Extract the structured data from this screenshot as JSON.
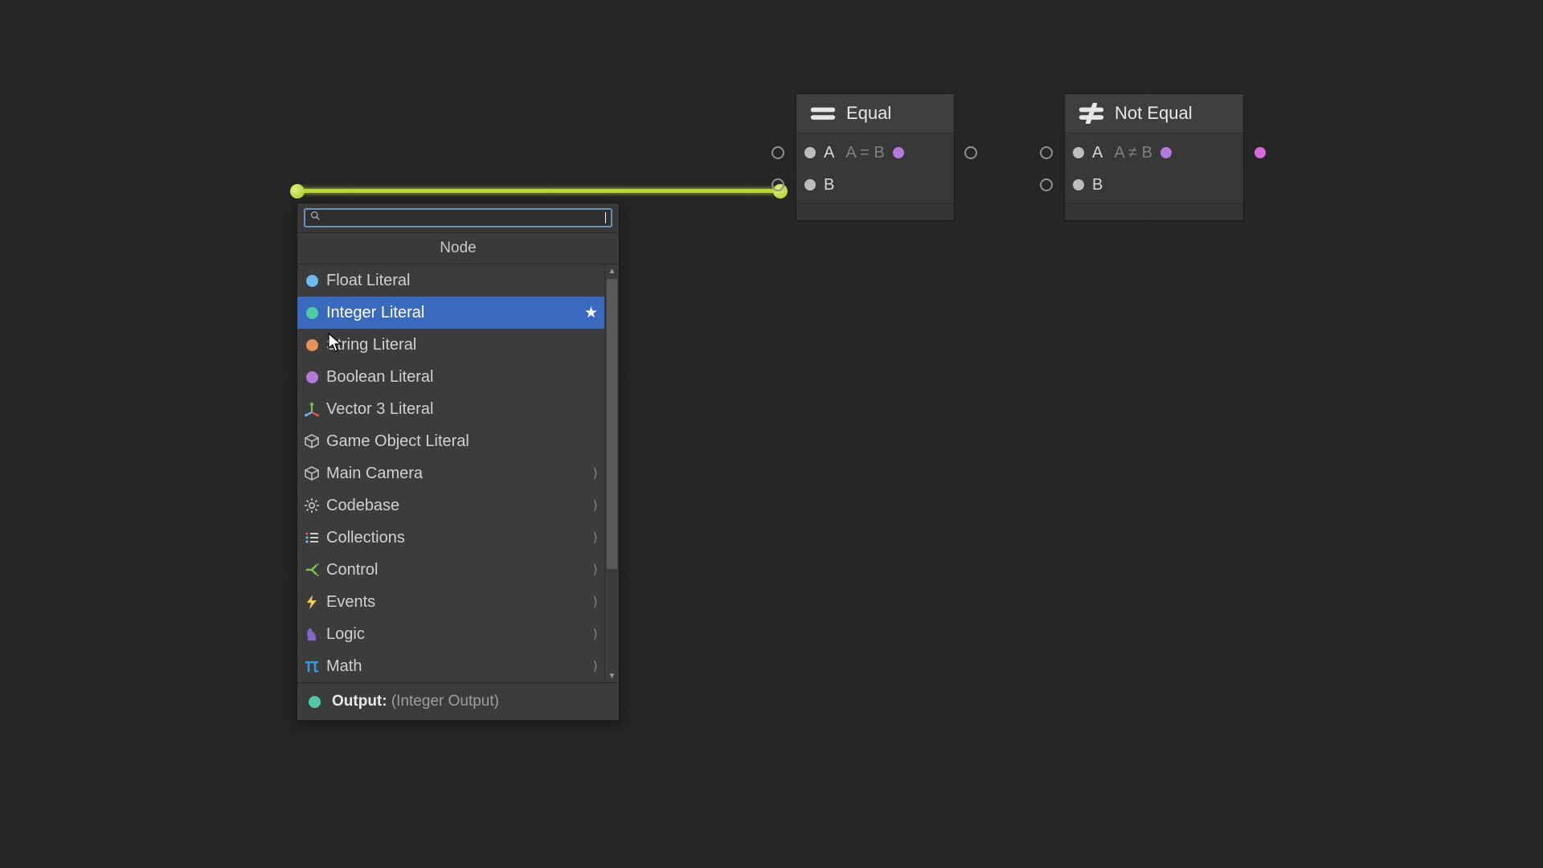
{
  "popup": {
    "header": "Node",
    "search_value": "",
    "items": [
      {
        "label": "Float Literal",
        "icon": "dot",
        "color": "#6fb8f0",
        "submenu": false
      },
      {
        "label": "Integer Literal",
        "icon": "dot",
        "color": "#4fc9a8",
        "submenu": false,
        "selected": true,
        "starred": true
      },
      {
        "label": "String Literal",
        "icon": "dot",
        "color": "#e3925c",
        "submenu": false
      },
      {
        "label": "Boolean Literal",
        "icon": "dot",
        "color": "#b479dd",
        "submenu": false
      },
      {
        "label": "Vector 3 Literal",
        "icon": "vector3",
        "color": "",
        "submenu": false
      },
      {
        "label": "Game Object Literal",
        "icon": "cube",
        "color": "#bbbbbb",
        "submenu": false
      },
      {
        "label": "Main Camera",
        "icon": "cube",
        "color": "#bbbbbb",
        "submenu": true
      },
      {
        "label": "Codebase",
        "icon": "gear",
        "color": "#cccccc",
        "submenu": true
      },
      {
        "label": "Collections",
        "icon": "list",
        "color": "",
        "submenu": true
      },
      {
        "label": "Control",
        "icon": "branch",
        "color": "#7ac74f",
        "submenu": true
      },
      {
        "label": "Events",
        "icon": "bolt",
        "color": "#f2c94c",
        "submenu": true
      },
      {
        "label": "Logic",
        "icon": "knight",
        "color": "#8566c6",
        "submenu": true
      },
      {
        "label": "Math",
        "icon": "pi",
        "color": "#3498db",
        "submenu": true
      }
    ],
    "footer_label": "Output:",
    "footer_value": "(Integer Output)",
    "footer_color": "#4fc9a8"
  },
  "nodes": {
    "equal": {
      "title": "Equal",
      "portA": "A",
      "portB": "B",
      "expr": "A = B"
    },
    "notequal": {
      "title": "Not Equal",
      "portA": "A",
      "portB": "B",
      "expr": "A ≠ B"
    }
  }
}
